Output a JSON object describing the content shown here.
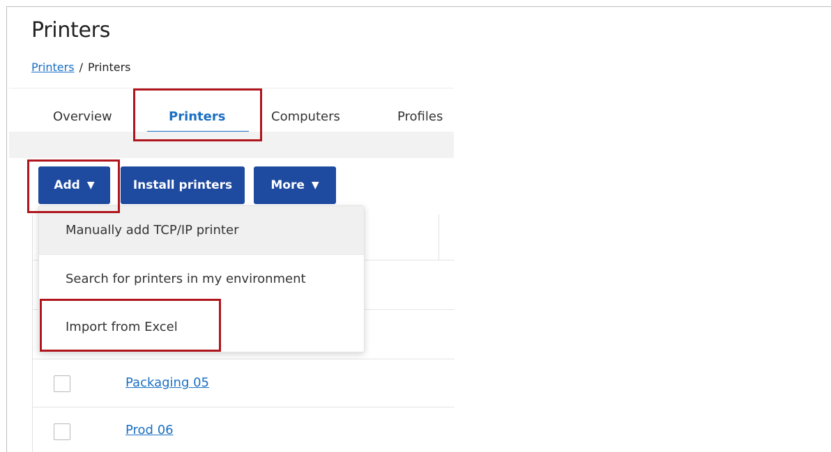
{
  "header": {
    "title": "Printers",
    "breadcrumb": {
      "link": "Printers",
      "separator": "/",
      "current": "Printers"
    }
  },
  "tabs": [
    {
      "label": "Overview",
      "active": false
    },
    {
      "label": "Printers",
      "active": true
    },
    {
      "label": "Computers",
      "active": false
    },
    {
      "label": "Profiles",
      "active": false
    }
  ],
  "toolbar": {
    "add_label": "Add",
    "install_label": "Install printers",
    "more_label": "More",
    "caret": "▼"
  },
  "add_menu": {
    "items": [
      "Manually add TCP/IP printer",
      "Search for printers in my environment",
      "Import from Excel"
    ]
  },
  "table": {
    "rows": [
      {
        "name": "Packaging 05"
      },
      {
        "name": "Prod 06"
      }
    ]
  },
  "colors": {
    "accent": "#1a6fc4",
    "button": "#1e4aa0",
    "highlight": "#b0141c"
  }
}
